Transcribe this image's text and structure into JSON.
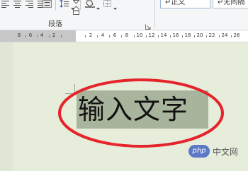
{
  "ribbon": {
    "paragraph_group_label": "段落",
    "styles": [
      {
        "label": "↵正文"
      },
      {
        "label": "↵无间隔"
      }
    ]
  },
  "ruler": {
    "labels": [
      "8",
      "6",
      "4",
      "2",
      "2",
      "4",
      "6",
      "8",
      "10",
      "12",
      "14",
      "16",
      "18",
      "20",
      "22",
      "24",
      "26"
    ]
  },
  "document": {
    "selected_text": "输入文字"
  },
  "watermark": {
    "logo": "php",
    "site": "中文网"
  },
  "colors": {
    "highlight": "#a9b49c",
    "annotation": "#e5242b",
    "page": "#e6eedb"
  },
  "icons": [
    "align-left-icon",
    "align-center-icon",
    "align-right-icon",
    "justify-icon",
    "distribute-icon",
    "line-spacing-icon",
    "shading-icon",
    "borders-icon",
    "dialog-launcher-icon",
    "indent-marker-icon"
  ]
}
